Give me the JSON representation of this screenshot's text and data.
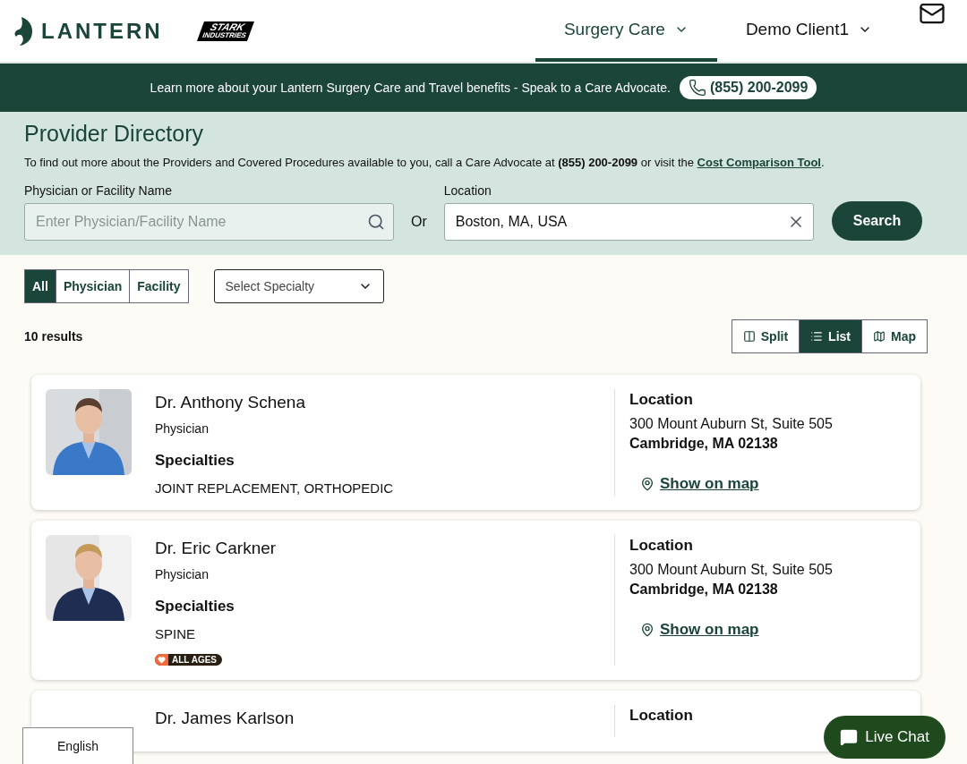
{
  "header": {
    "logo": "LANTERN",
    "partner_logo": {
      "line1": "STARK",
      "line2": "INDUSTRIES"
    },
    "nav": [
      {
        "label": "Surgery Care",
        "selected": true
      },
      {
        "label": "Demo Client1",
        "selected": false
      }
    ]
  },
  "banner": {
    "text": "Learn more about your Lantern Surgery Care and Travel benefits - Speak to a Care Advocate.",
    "phone": "(855) 200-2099"
  },
  "directory": {
    "title": "Provider Directory",
    "intro": "To find out more about the Providers and Covered Procedures available to you, call a Care Advocate at **(855) 200-2099** or visit the ",
    "intro_link": "Cost Comparison Tool",
    "intro_end": ".",
    "name_field": {
      "label": "Physician or Facility Name",
      "placeholder": "Enter Physician/Facility Name"
    },
    "or": "Or",
    "location_field": {
      "label": "Location",
      "value": "Boston, MA, USA"
    },
    "search_button": "Search"
  },
  "filters": {
    "types": [
      {
        "label": "All",
        "selected": true
      },
      {
        "label": "Physician",
        "selected": false
      },
      {
        "label": "Facility",
        "selected": false
      }
    ],
    "specialty": {
      "placeholder": "Select Specialty"
    }
  },
  "results": {
    "count": "10 results",
    "views": [
      {
        "kind": "split",
        "label": "Split",
        "selected": false
      },
      {
        "kind": "list",
        "label": "List",
        "selected": true
      },
      {
        "kind": "map",
        "label": "Map",
        "selected": false
      }
    ]
  },
  "providers": [
    {
      "name": "Dr. Anthony Schena",
      "type": "Physician",
      "specialties_heading": "Specialties",
      "specialties": "JOINT REPLACEMENT, ORTHOPEDIC",
      "location_heading": "Location",
      "address": "300 Mount Auburn St, Suite 505",
      "city": "Cambridge, MA 02138",
      "map_link": "Show on map"
    },
    {
      "name": "Dr. Eric Carkner",
      "type": "Physician",
      "specialties_heading": "Specialties",
      "specialties": "SPINE",
      "badge": "ALL AGES",
      "location_heading": "Location",
      "address": "300 Mount Auburn St, Suite 505",
      "city": "Cambridge, MA 02138",
      "map_link": "Show on map"
    },
    {
      "name": "Dr. James Karlson",
      "location_heading": "Location"
    }
  ],
  "language": "English",
  "chat": "Live Chat"
}
